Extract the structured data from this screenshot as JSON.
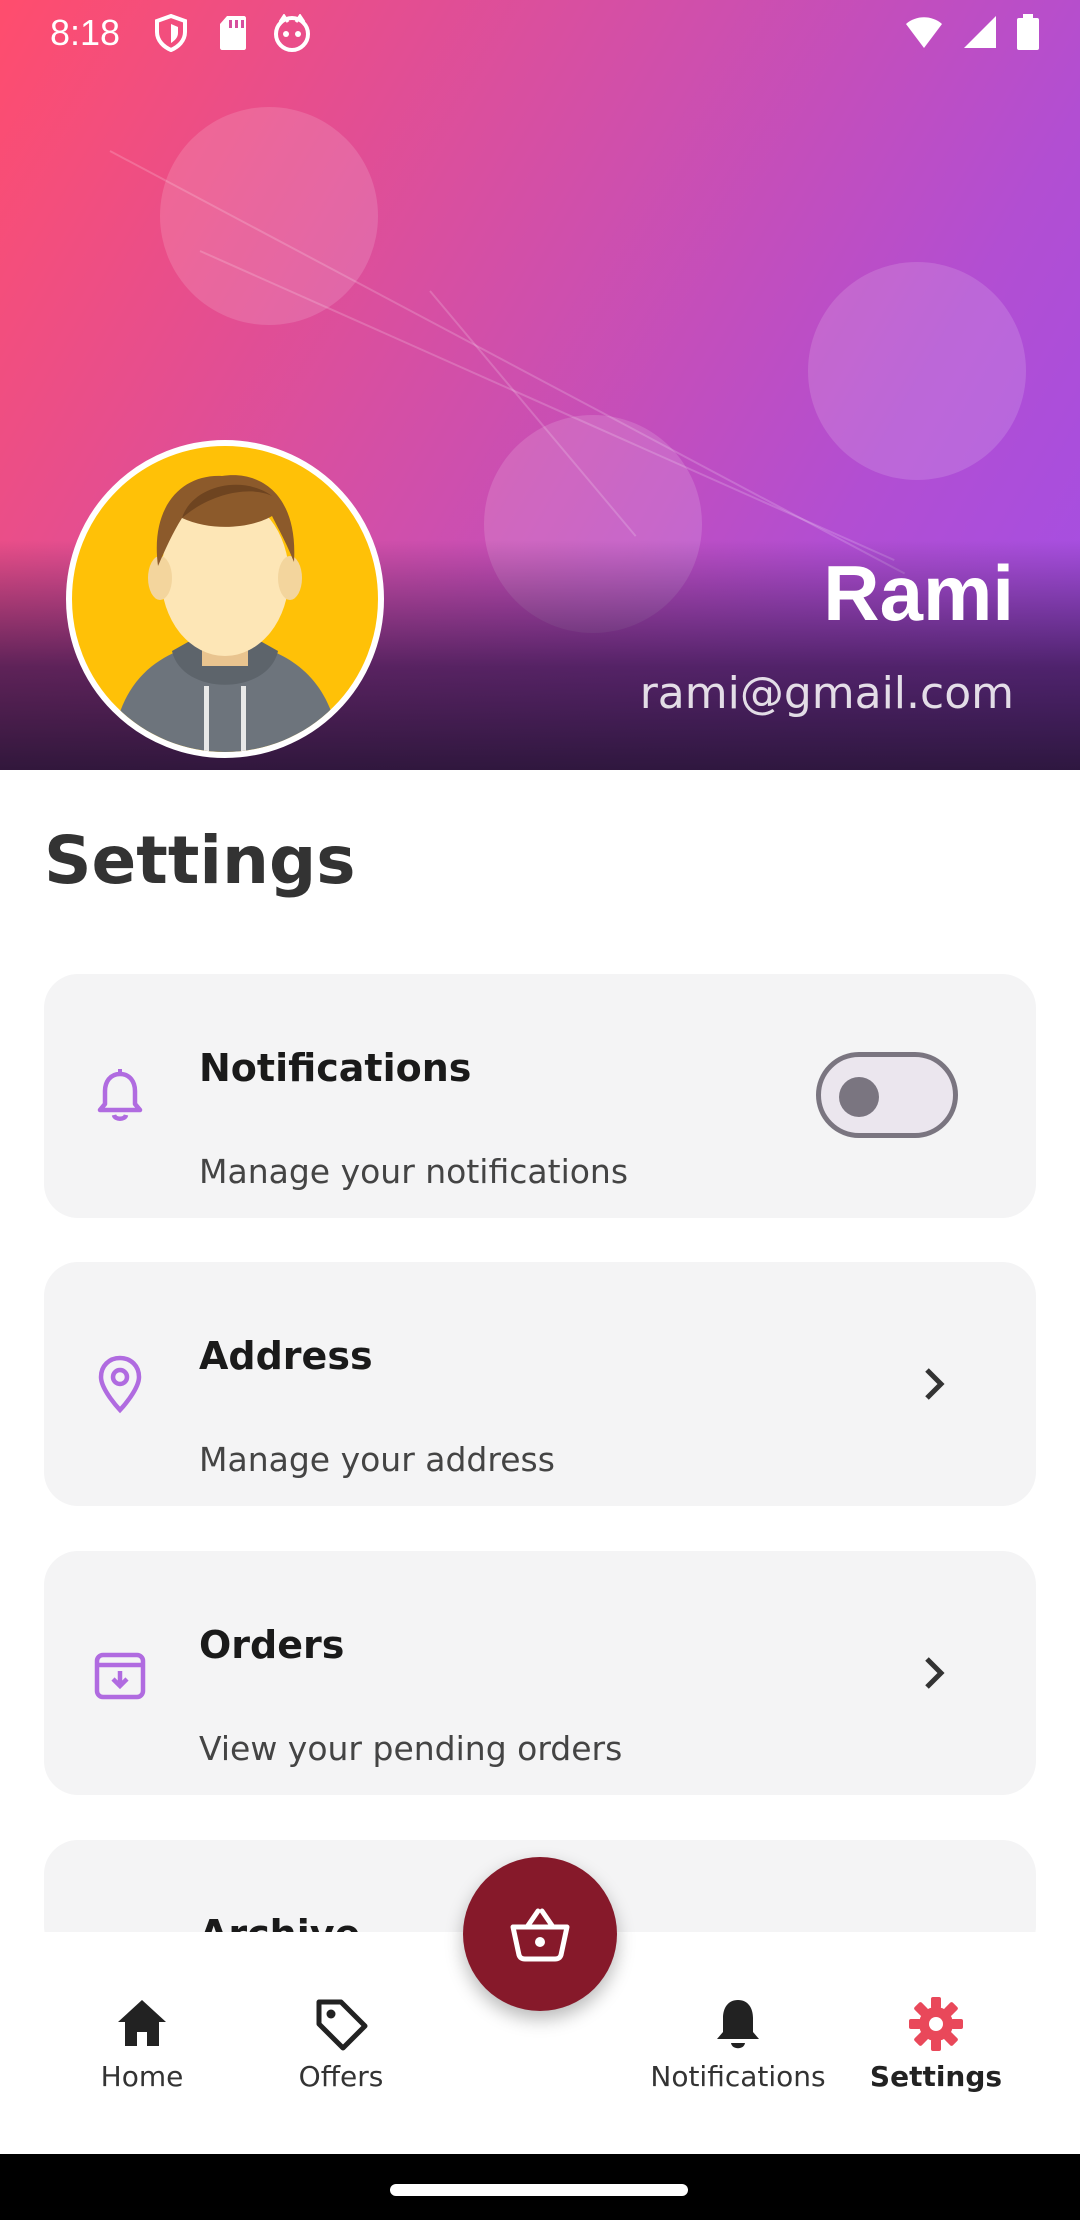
{
  "status_bar": {
    "time": "8:18",
    "left_icons": [
      "shield-icon",
      "sd-card-icon",
      "cat-icon"
    ],
    "right_icons": [
      "wifi-icon",
      "signal-icon",
      "battery-icon"
    ]
  },
  "profile": {
    "name": "Rami",
    "email": "rami@gmail.com",
    "avatar_color": "#ffc107"
  },
  "page": {
    "title": "Settings"
  },
  "settings": [
    {
      "title": "Notifications",
      "subtitle": "Manage your notifications",
      "icon": "bell-outline-icon",
      "control": "toggle",
      "toggle_on": false
    },
    {
      "title": "Address",
      "subtitle": "Manage your address",
      "icon": "location-pin-icon",
      "control": "chevron"
    },
    {
      "title": "Orders",
      "subtitle": "View your pending orders",
      "icon": "archive-down-icon",
      "control": "chevron"
    },
    {
      "title": "Archive",
      "icon": "archive-icon"
    }
  ],
  "nav": {
    "items": [
      {
        "label": "Home",
        "icon": "home-icon"
      },
      {
        "label": "Offers",
        "icon": "tag-icon"
      },
      {
        "label": "Notifications",
        "icon": "bell-icon"
      },
      {
        "label": "Settings",
        "icon": "gear-icon",
        "active": true
      }
    ],
    "fab_icon": "basket-icon"
  },
  "colors": {
    "accent": "#b06be0",
    "fab": "#86192a",
    "active_nav": "#e9485a",
    "card_bg": "#f4f4f5"
  }
}
